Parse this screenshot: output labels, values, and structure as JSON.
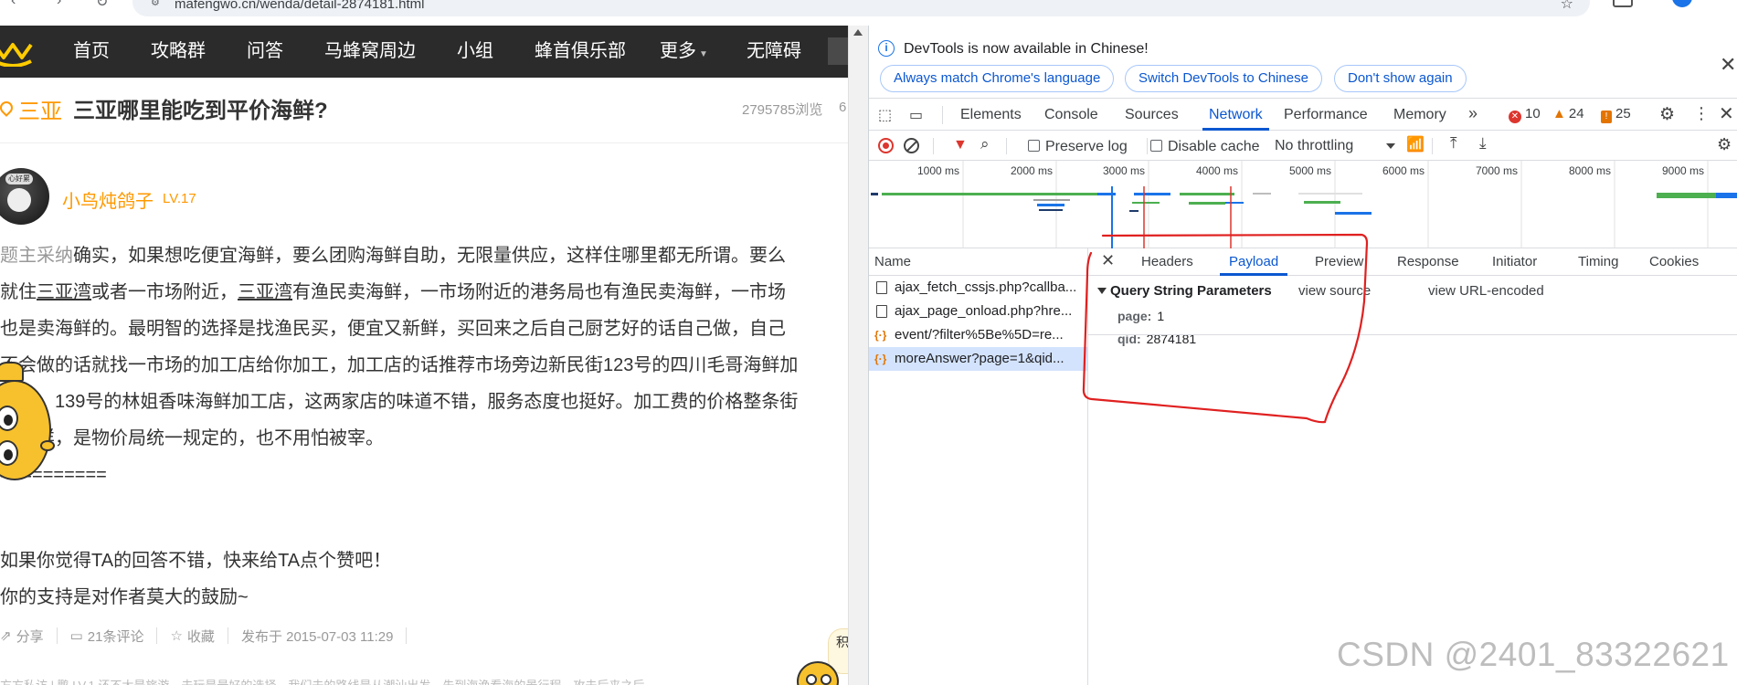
{
  "browser": {
    "url": "mafengwo.cn/wenda/detail-2874181.html"
  },
  "site": {
    "nav": [
      "首页",
      "攻略群",
      "问答",
      "马蜂窝周边",
      "小组",
      "蜂首俱乐部"
    ],
    "nav_more": "更多",
    "nav_accessible": "无障碍",
    "question": {
      "city": "三亚",
      "title": "三亚哪里能吃到平价海鲜?",
      "views": "2795785浏览",
      "views_cut": "6"
    },
    "user": {
      "name": "小鸟炖鸽子",
      "level": "LV.17",
      "avatar_hat": "心好累"
    },
    "answer_lines": [
      [
        "题主采纳",
        "确实，如果想吃便宜海鲜，要么团购海鲜自助，无限量供应，这样住哪里都无所谓。要么"
      ],
      [
        "就住",
        "三亚湾",
        "或者一市场附近，",
        "三亚湾",
        "有渔民卖海鲜，一市场附近的港务局也有渔民卖海鲜，一市场"
      ],
      [
        "也是卖海鲜的。最明智的选择是找渔民买，便宜又新鲜，买回来之后自己厨艺好的话自己做，自己"
      ],
      [
        "不会做的话就找一市场的加工店给你加工，加工店的话推荐市场旁边新民街123号的四川毛哥海鲜加"
      ],
      [
        "工店，139号的林姐香味海鲜加工店，这两家店的味道不错，服务态度也挺好。加工费的价格整条街"
      ],
      [
        "都一样，是物价局统一规定的，也不用怕被宰。"
      ],
      [
        "=========="
      ]
    ],
    "outro": [
      "如果你觉得TA的回答不错，快来给TA点个赞吧！",
      "你的支持是对作者莫大的鼓励~"
    ],
    "actions": {
      "share": "分享",
      "comments": "21条评论",
      "favorite": "收藏",
      "published": "发布于 2015-07-03 11:29"
    },
    "bottom_strip": "方方私访 | 鹏 LV.1   还不太是旅游，去玩是最好的选择，我们去的路线是从潮汕出发，先到海渔看海的景行程，攻去后来之后",
    "float_chip": "积"
  },
  "devtools": {
    "info": {
      "message": "DevTools is now available in Chinese!",
      "buttons": [
        "Always match Chrome's language",
        "Switch DevTools to Chinese",
        "Don't show again"
      ]
    },
    "tabs": [
      "Elements",
      "Console",
      "Sources",
      "Network",
      "Performance",
      "Memory"
    ],
    "active_tab": "Network",
    "counts": {
      "errors": "10",
      "warnings": "24",
      "issues": "25"
    },
    "toolbar": {
      "preserve_log": "Preserve log",
      "disable_cache": "Disable cache",
      "throttling": "No throttling"
    },
    "timeline": {
      "ticks": [
        "1000 ms",
        "2000 ms",
        "3000 ms",
        "4000 ms",
        "5000 ms",
        "6000 ms",
        "7000 ms",
        "8000 ms",
        "9000 ms"
      ]
    },
    "requests_header": "Name",
    "requests": [
      {
        "name": "ajax_fetch_cssjs.php?callba...",
        "type": "doc",
        "selected": false
      },
      {
        "name": "ajax_page_onload.php?hre...",
        "type": "doc",
        "selected": false
      },
      {
        "name": "event/?filter%5Be%5D=re...",
        "type": "xhr",
        "selected": false
      },
      {
        "name": "moreAnswer?page=1&qid...",
        "type": "xhr",
        "selected": true
      }
    ],
    "detail_tabs": [
      "Headers",
      "Payload",
      "Preview",
      "Response",
      "Initiator",
      "Timing",
      "Cookies"
    ],
    "active_detail_tab": "Payload",
    "payload": {
      "section": "Query String Parameters",
      "view_source": "view source",
      "view_encoded": "view URL-encoded",
      "params": [
        {
          "key": "page:",
          "value": "1"
        },
        {
          "key": "qid:",
          "value": "2874181"
        }
      ]
    }
  },
  "watermark": "CSDN @2401_83322621",
  "colors": {
    "brand_orange": "#ff9900",
    "nav_dark": "#2b2b2b",
    "devtools_blue": "#0b57d0",
    "annotation_red": "#e02020"
  }
}
